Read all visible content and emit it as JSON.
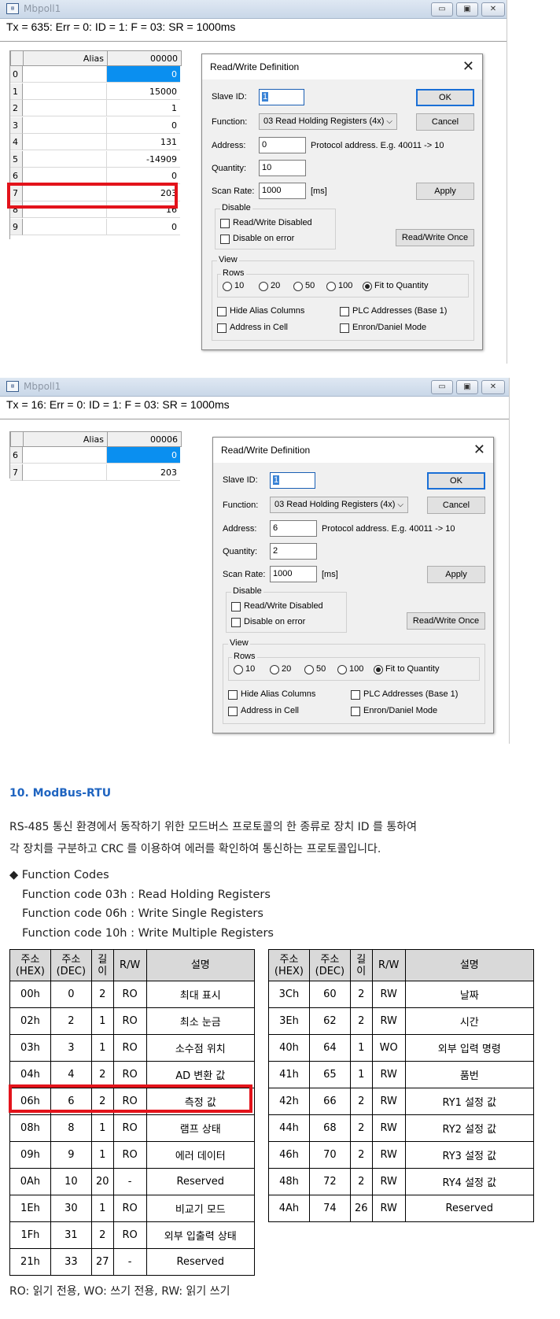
{
  "windows": [
    {
      "title": "Mbpoll1",
      "status": "Tx = 635: Err = 0: ID = 1: F = 03: SR = 1000ms",
      "grid": {
        "alias_header": "Alias",
        "addr_header": "00000",
        "rows": [
          {
            "n": "0",
            "v": "0"
          },
          {
            "n": "1",
            "v": "15000"
          },
          {
            "n": "2",
            "v": "1"
          },
          {
            "n": "3",
            "v": "0"
          },
          {
            "n": "4",
            "v": "131"
          },
          {
            "n": "5",
            "v": "-14909"
          },
          {
            "n": "6",
            "v": "0"
          },
          {
            "n": "7",
            "v": "203"
          },
          {
            "n": "8",
            "v": "16"
          },
          {
            "n": "9",
            "v": "0"
          }
        ]
      },
      "dialog": {
        "title": "Read/Write Definition",
        "slave_id_label": "Slave ID:",
        "slave_id": "1",
        "function_label": "Function:",
        "function": "03 Read Holding Registers (4x)",
        "address_label": "Address:",
        "address": "0",
        "address_hint": "Protocol address. E.g. 40011 -> 10",
        "quantity_label": "Quantity:",
        "quantity": "10",
        "scan_rate_label": "Scan Rate:",
        "scan_rate": "1000",
        "scan_unit": "[ms]",
        "ok": "OK",
        "cancel": "Cancel",
        "apply": "Apply",
        "rw_once": "Read/Write Once",
        "disable_group": "Disable",
        "rw_disabled": "Read/Write Disabled",
        "disable_on_error": "Disable on error",
        "view_group": "View",
        "rows_group": "Rows",
        "r10": "10",
        "r20": "20",
        "r50": "50",
        "r100": "100",
        "fit": "Fit to Quantity",
        "hide_alias": "Hide Alias Columns",
        "plc_addr": "PLC Addresses (Base 1)",
        "addr_in_cell": "Address in Cell",
        "enron": "Enron/Daniel Mode"
      }
    },
    {
      "title": "Mbpoll1",
      "status": "Tx = 16: Err = 0: ID = 1: F = 03: SR = 1000ms",
      "grid": {
        "alias_header": "Alias",
        "addr_header": "00006",
        "rows": [
          {
            "n": "6",
            "v": "0"
          },
          {
            "n": "7",
            "v": "203"
          }
        ]
      },
      "dialog": {
        "title": "Read/Write Definition",
        "slave_id_label": "Slave ID:",
        "slave_id": "1",
        "function_label": "Function:",
        "function": "03 Read Holding Registers (4x)",
        "address_label": "Address:",
        "address": "6",
        "address_hint": "Protocol address. E.g. 40011 -> 10",
        "quantity_label": "Quantity:",
        "quantity": "2",
        "scan_rate_label": "Scan Rate:",
        "scan_rate": "1000",
        "scan_unit": "[ms]",
        "ok": "OK",
        "cancel": "Cancel",
        "apply": "Apply",
        "rw_once": "Read/Write Once",
        "disable_group": "Disable",
        "rw_disabled": "Read/Write Disabled",
        "disable_on_error": "Disable on error",
        "view_group": "View",
        "rows_group": "Rows",
        "r10": "10",
        "r20": "20",
        "r50": "50",
        "r100": "100",
        "fit": "Fit to Quantity",
        "hide_alias": "Hide Alias Columns",
        "plc_addr": "PLC Addresses (Base 1)",
        "addr_in_cell": "Address in Cell",
        "enron": "Enron/Daniel Mode"
      }
    }
  ],
  "doc": {
    "section_title": "10. ModBus-RTU",
    "para_line1": "RS-485 통신 환경에서 동작하기 위한 모드버스 프로토콜의 한 종류로 장치 ID 를 통하여",
    "para_line2": "각 장치를 구분하고 CRC 를 이용하여 에러를 확인하여 통신하는 프로토콜입니다.",
    "fc_title": "◆  Function Codes",
    "fc_lines": [
      "Function code 03h : Read Holding Registers",
      "Function code 06h : Write Single Registers",
      "Function code 10h : Write Multiple Registers"
    ],
    "table_headers": [
      "주소\n(HEX)",
      "주소\n(DEC)",
      "길\n이",
      "R/W",
      "설명"
    ],
    "left_table": [
      [
        "00h",
        "0",
        "2",
        "RO",
        "최대 표시"
      ],
      [
        "02h",
        "2",
        "1",
        "RO",
        "최소 눈금"
      ],
      [
        "03h",
        "3",
        "1",
        "RO",
        "소수점 위치"
      ],
      [
        "04h",
        "4",
        "2",
        "RO",
        "AD 변환 값"
      ],
      [
        "06h",
        "6",
        "2",
        "RO",
        "측정 값"
      ],
      [
        "08h",
        "8",
        "1",
        "RO",
        "램프 상태"
      ],
      [
        "09h",
        "9",
        "1",
        "RO",
        "에러 데이터"
      ],
      [
        "0Ah",
        "10",
        "20",
        "-",
        "Reserved"
      ],
      [
        "1Eh",
        "30",
        "1",
        "RO",
        "비교기 모드"
      ],
      [
        "1Fh",
        "31",
        "2",
        "RO",
        "외부 입출력 상태"
      ],
      [
        "21h",
        "33",
        "27",
        "-",
        "Reserved"
      ]
    ],
    "right_table": [
      [
        "3Ch",
        "60",
        "2",
        "RW",
        "날짜"
      ],
      [
        "3Eh",
        "62",
        "2",
        "RW",
        "시간"
      ],
      [
        "40h",
        "64",
        "1",
        "WO",
        "외부 입력 명령"
      ],
      [
        "41h",
        "65",
        "1",
        "RW",
        "품번"
      ],
      [
        "42h",
        "66",
        "2",
        "RW",
        "RY1 설정 값"
      ],
      [
        "44h",
        "68",
        "2",
        "RW",
        "RY2 설정 값"
      ],
      [
        "46h",
        "70",
        "2",
        "RW",
        "RY3 설정 값"
      ],
      [
        "48h",
        "72",
        "2",
        "RW",
        "RY4 설정 값"
      ],
      [
        "4Ah",
        "74",
        "26",
        "RW",
        "Reserved"
      ]
    ],
    "legend": "RO: 읽기 전용, WO: 쓰기 전용, RW: 읽기 쓰기"
  },
  "colors": {
    "highlight": "#e3131b",
    "selected_cell": "#0a8ff0",
    "heading": "#1f64c0"
  },
  "icons": [
    "app-icon",
    "minimize-icon",
    "maximize-icon",
    "close-icon",
    "chevron-down-icon"
  ]
}
